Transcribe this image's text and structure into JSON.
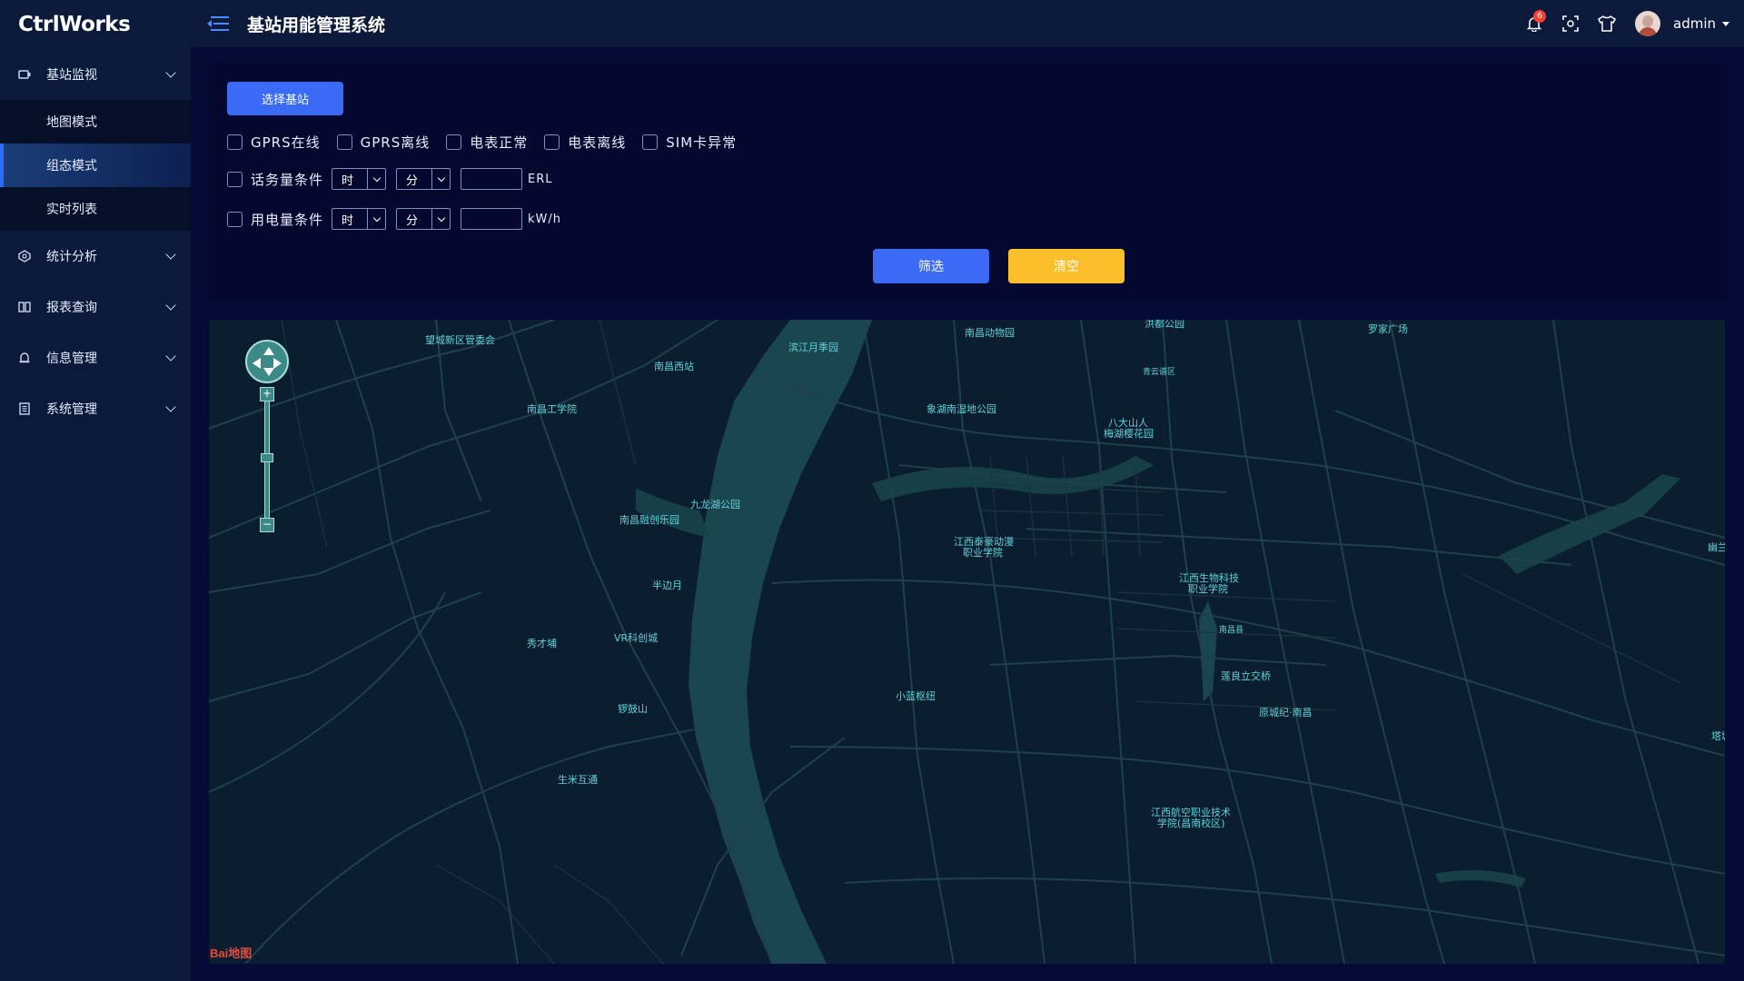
{
  "app": {
    "logo": "CtrlWorks",
    "system_title": "基站用能管理系统"
  },
  "header": {
    "notification_count": "6",
    "username": "admin",
    "icons": [
      "bell-icon",
      "fullscreen-icon",
      "theme-shirt-icon"
    ]
  },
  "sidebar": {
    "groups": [
      {
        "label": "基站监视",
        "icon": "monitor-icon",
        "expanded": true,
        "items": [
          {
            "label": "地图模式",
            "active": false
          },
          {
            "label": "组态模式",
            "active": true
          },
          {
            "label": "实时列表",
            "active": false
          }
        ]
      },
      {
        "label": "统计分析",
        "icon": "stats-icon",
        "expanded": false
      },
      {
        "label": "报表查询",
        "icon": "report-icon",
        "expanded": false
      },
      {
        "label": "信息管理",
        "icon": "info-icon",
        "expanded": false
      },
      {
        "label": "系统管理",
        "icon": "system-icon",
        "expanded": false
      }
    ]
  },
  "filter": {
    "select_station_label": "选择基站",
    "status_checks": [
      "GPRS在线",
      "GPRS离线",
      "电表正常",
      "电表离线",
      "SIM卡异常"
    ],
    "traffic": {
      "label": "话务量条件",
      "hour": "时",
      "minute": "分",
      "value": "",
      "unit": "ERL"
    },
    "power": {
      "label": "用电量条件",
      "hour": "时",
      "minute": "分",
      "value": "",
      "unit": "kW/h"
    },
    "filter_button": "筛选",
    "clear_button": "清空"
  },
  "map": {
    "labels": [
      "望城新区管委会",
      "南昌西站",
      "滨江月季园",
      "南昌动物园",
      "洪都公园",
      "罗家广场",
      "青云谱区",
      "南昌工学院",
      "象湖南湿地公园",
      "八大山人",
      "梅湖樱花园",
      "九龙湖公园",
      "南昌融创乐园",
      "江西泰豪动漫",
      "职业学院",
      "半边月",
      "江西生物科技",
      "职业学院",
      "幽兰",
      "秀才埔",
      "VR科创城",
      "南昌县",
      "莲良立交桥",
      "小蓝枢纽",
      "原城纪·南昌",
      "锣鼓山",
      "塔城",
      "生米互通",
      "江西航空职业技术",
      "学院(昌南校区)"
    ],
    "logo_text": "Bai地图"
  }
}
